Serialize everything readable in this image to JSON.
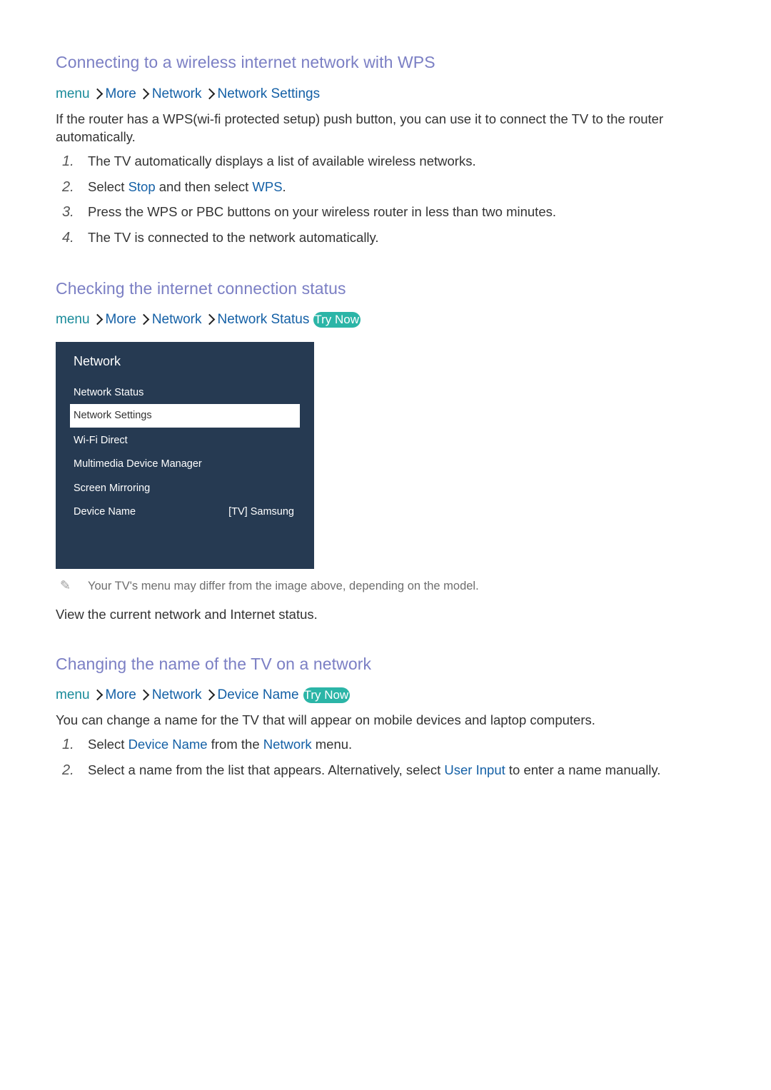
{
  "sections": [
    {
      "heading": "Connecting to a wireless internet network with WPS",
      "path": {
        "root": "menu",
        "items": [
          "More",
          "Network",
          "Network Settings"
        ],
        "try_now": null
      },
      "intro": "If the router has a WPS(wi-fi protected setup) push button, you can use it to connect the TV to the router automatically.",
      "steps": [
        {
          "num": "1.",
          "parts": [
            {
              "t": "The TV automatically displays a list of available wireless networks."
            }
          ]
        },
        {
          "num": "2.",
          "parts": [
            {
              "t": "Select "
            },
            {
              "t": "Stop",
              "kw": true
            },
            {
              "t": " and then select "
            },
            {
              "t": "WPS",
              "kw": true
            },
            {
              "t": "."
            }
          ]
        },
        {
          "num": "3.",
          "parts": [
            {
              "t": "Press the WPS or PBC buttons on your wireless router in less than two minutes."
            }
          ]
        },
        {
          "num": "4.",
          "parts": [
            {
              "t": "The TV is connected to the network automatically."
            }
          ]
        }
      ]
    },
    {
      "heading": "Checking the internet connection status",
      "path": {
        "root": "menu",
        "items": [
          "More",
          "Network",
          "Network Status"
        ],
        "try_now": "Try Now"
      }
    },
    {
      "heading": "Changing the name of the TV on a network",
      "path": {
        "root": "menu",
        "items": [
          "More",
          "Network",
          "Device Name"
        ],
        "try_now": "Try Now"
      },
      "intro": "You can change a name for the TV that will appear on mobile devices and laptop computers.",
      "steps": [
        {
          "num": "1.",
          "parts": [
            {
              "t": "Select "
            },
            {
              "t": "Device Name",
              "kw": true
            },
            {
              "t": " from the "
            },
            {
              "t": "Network",
              "kw": true
            },
            {
              "t": " menu."
            }
          ]
        },
        {
          "num": "2.",
          "parts": [
            {
              "t": "Select a name from the list that appears. Alternatively, select "
            },
            {
              "t": "User Input",
              "kw": true
            },
            {
              "t": " to enter a name manually."
            }
          ]
        }
      ]
    }
  ],
  "tv_menu": {
    "title": "Network",
    "items": [
      {
        "label": "Network Status",
        "value": "",
        "selected": false
      },
      {
        "label": "Network Settings",
        "value": "",
        "selected": true
      },
      {
        "label": "Wi-Fi Direct",
        "value": "",
        "selected": false
      },
      {
        "label": "Multimedia Device Manager",
        "value": "",
        "selected": false
      },
      {
        "label": "Screen Mirroring",
        "value": "",
        "selected": false
      },
      {
        "label": "Device Name",
        "value": "[TV] Samsung",
        "selected": false
      }
    ]
  },
  "note": {
    "icon": "pencil-icon",
    "text": "Your TV's menu may differ from the image above, depending on the model."
  },
  "status_description": "View the current network and Internet status."
}
